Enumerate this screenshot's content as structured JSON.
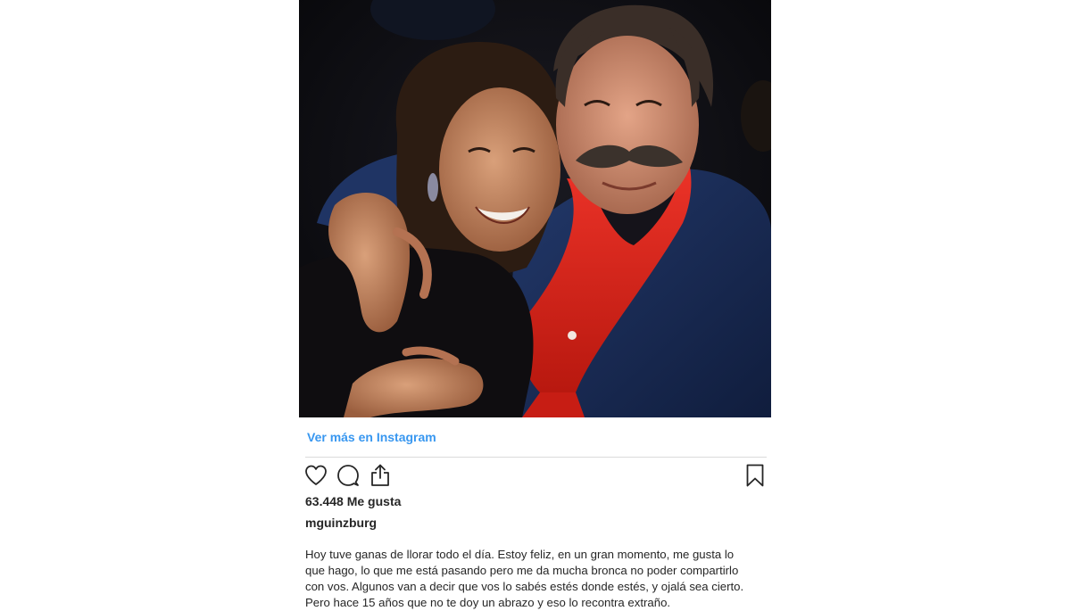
{
  "post": {
    "view_more_label": "Ver más en Instagram",
    "likes_text": "63.448 Me gusta",
    "username": "mguinzburg",
    "caption_lines": [
      "Hoy tuve ganas de llorar todo el día. Estoy feliz, en un gran momento, me gusta lo",
      "que hago, lo que me está pasando pero me da mucha bronca no poder compartirlo",
      "con vos. Algunos van a decir que vos lo sabés estés donde estés, y ojalá sea cierto.",
      "Pero hace 15 años que no te doy un abrazo y eso lo recontra extraño."
    ]
  },
  "icons": {
    "like": "heart-icon",
    "comment": "comment-icon",
    "share": "share-icon",
    "save": "bookmark-icon"
  },
  "colors": {
    "link": "#3897f0",
    "text": "#262626",
    "divider": "#dbdbdb",
    "scarf": "#e0261d",
    "jacket": "#1b2f5a"
  }
}
